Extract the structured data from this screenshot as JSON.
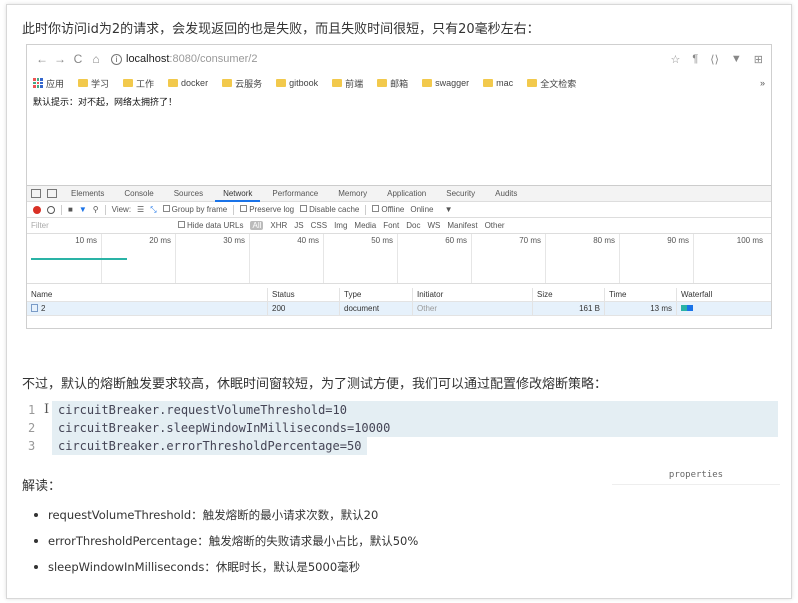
{
  "intro_text": "此时你访问id为2的请求，会发现返回的也是失败，而且失败时间很短，只有20毫秒左右：",
  "browser": {
    "nav": {
      "back": "←",
      "forward": "→",
      "reload": "C",
      "home": "⌂"
    },
    "url_host": "localhost",
    "url_rest": ":8080/consumer/2",
    "ext_icons": [
      "☆",
      "¶",
      "⟨⟩",
      "▼",
      "⊞"
    ],
    "bookmarks": [
      "应用",
      "学习",
      "工作",
      "docker",
      "云服务",
      "gitbook",
      "前端",
      "邮箱",
      "swagger",
      "mac",
      "全文检索"
    ],
    "bookmarks_more": "»",
    "page_message": "默认提示：对不起，网络太拥挤了！",
    "devtools": {
      "tabs": [
        "Elements",
        "Console",
        "Sources",
        "Network",
        "Performance",
        "Memory",
        "Application",
        "Security",
        "Audits"
      ],
      "active_tab": "Network",
      "toolbar": {
        "view": "View:",
        "group_by_frame": "Group by frame",
        "preserve_log": "Preserve log",
        "disable_cache": "Disable cache",
        "offline": "Offline",
        "throttle": "Online",
        "throttle_arrow": "▼"
      },
      "filter": {
        "placeholder": "Filter",
        "hide_data_urls": "Hide data URLs",
        "all": "All",
        "types": [
          "XHR",
          "JS",
          "CSS",
          "Img",
          "Media",
          "Font",
          "Doc",
          "WS",
          "Manifest",
          "Other"
        ]
      },
      "timeline_ticks": [
        "10 ms",
        "20 ms",
        "30 ms",
        "40 ms",
        "50 ms",
        "60 ms",
        "70 ms",
        "80 ms",
        "90 ms",
        "100 ms"
      ],
      "columns": [
        "Name",
        "Status",
        "Type",
        "Initiator",
        "Size",
        "Time",
        "Waterfall"
      ],
      "rows": [
        {
          "name": "2",
          "status": "200",
          "type": "document",
          "initiator": "Other",
          "size": "161 B",
          "time": "13 ms"
        }
      ]
    }
  },
  "para2": "不过，默认的熔断触发要求较高，休眠时间窗较短，为了测试方便，我们可以通过配置修改熔断策略：",
  "code": {
    "cursor": "I",
    "lines": [
      {
        "num": "1",
        "text": "circuitBreaker.requestVolumeThreshold=10"
      },
      {
        "num": "2",
        "text": "circuitBreaker.sleepWindowInMilliseconds=10000"
      },
      {
        "num": "3",
        "text": "circuitBreaker.errorThresholdPercentage=50"
      }
    ],
    "language": "properties"
  },
  "explain_title": "解读：",
  "bullets": [
    "requestVolumeThreshold：触发熔断的最小请求次数，默认20",
    "errorThresholdPercentage：触发熔断的失败请求最小占比，默认50%",
    "sleepWindowInMilliseconds：休眠时长，默认是5000毫秒"
  ]
}
